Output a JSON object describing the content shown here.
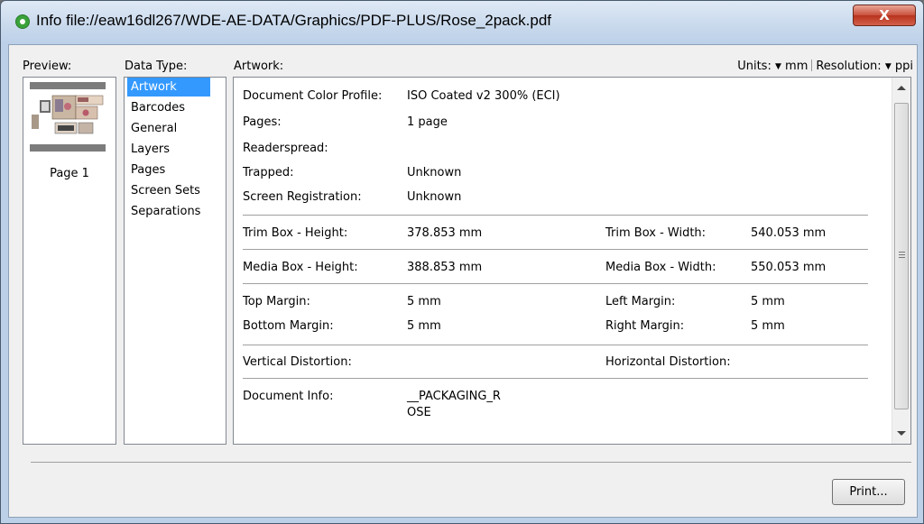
{
  "window": {
    "title": "Info file://eaw16dl267/WDE-AE-DATA/Graphics/PDF-PLUS/Rose_2pack.pdf",
    "close_label": "X"
  },
  "headers": {
    "preview": "Preview:",
    "data_type": "Data Type:",
    "artwork": "Artwork:",
    "units_label": "Units:",
    "units_value": "mm",
    "resolution_label": "Resolution:",
    "resolution_value": "ppi"
  },
  "preview": {
    "page_label": "Page 1"
  },
  "data_types": [
    {
      "label": "Artwork",
      "selected": true
    },
    {
      "label": "Barcodes"
    },
    {
      "label": "General"
    },
    {
      "label": "Layers"
    },
    {
      "label": "Pages"
    },
    {
      "label": "Screen Sets"
    },
    {
      "label": "Separations"
    }
  ],
  "artwork": {
    "doc_color_profile_label": "Document Color Profile:",
    "doc_color_profile_value": "ISO Coated v2 300% (ECI)",
    "pages_label": "Pages:",
    "pages_value": "1 page",
    "readerspread_label": "Readerspread:",
    "trapped_label": "Trapped:",
    "trapped_value": "Unknown",
    "screen_reg_label": "Screen Registration:",
    "screen_reg_value": "Unknown",
    "trim_height_label": "Trim Box - Height:",
    "trim_height_value": "378.853 mm",
    "trim_width_label": "Trim Box - Width:",
    "trim_width_value": "540.053 mm",
    "media_height_label": "Media Box - Height:",
    "media_height_value": "388.853 mm",
    "media_width_label": "Media Box - Width:",
    "media_width_value": "550.053 mm",
    "top_margin_label": "Top Margin:",
    "top_margin_value": "5 mm",
    "left_margin_label": "Left Margin:",
    "left_margin_value": "5 mm",
    "bottom_margin_label": "Bottom Margin:",
    "bottom_margin_value": "5 mm",
    "right_margin_label": "Right Margin:",
    "right_margin_value": "5 mm",
    "vertical_distortion_label": "Vertical Distortion:",
    "horizontal_distortion_label": "Horizontal Distortion:",
    "doc_info_label": "Document Info:",
    "doc_info_line1": "__PACKAGING_R",
    "doc_info_line2": "OSE"
  },
  "buttons": {
    "print": "Print..."
  },
  "colors": {
    "selection": "#3399ff",
    "close_button": "#c8503c",
    "title_icon": "#3aa23a"
  }
}
